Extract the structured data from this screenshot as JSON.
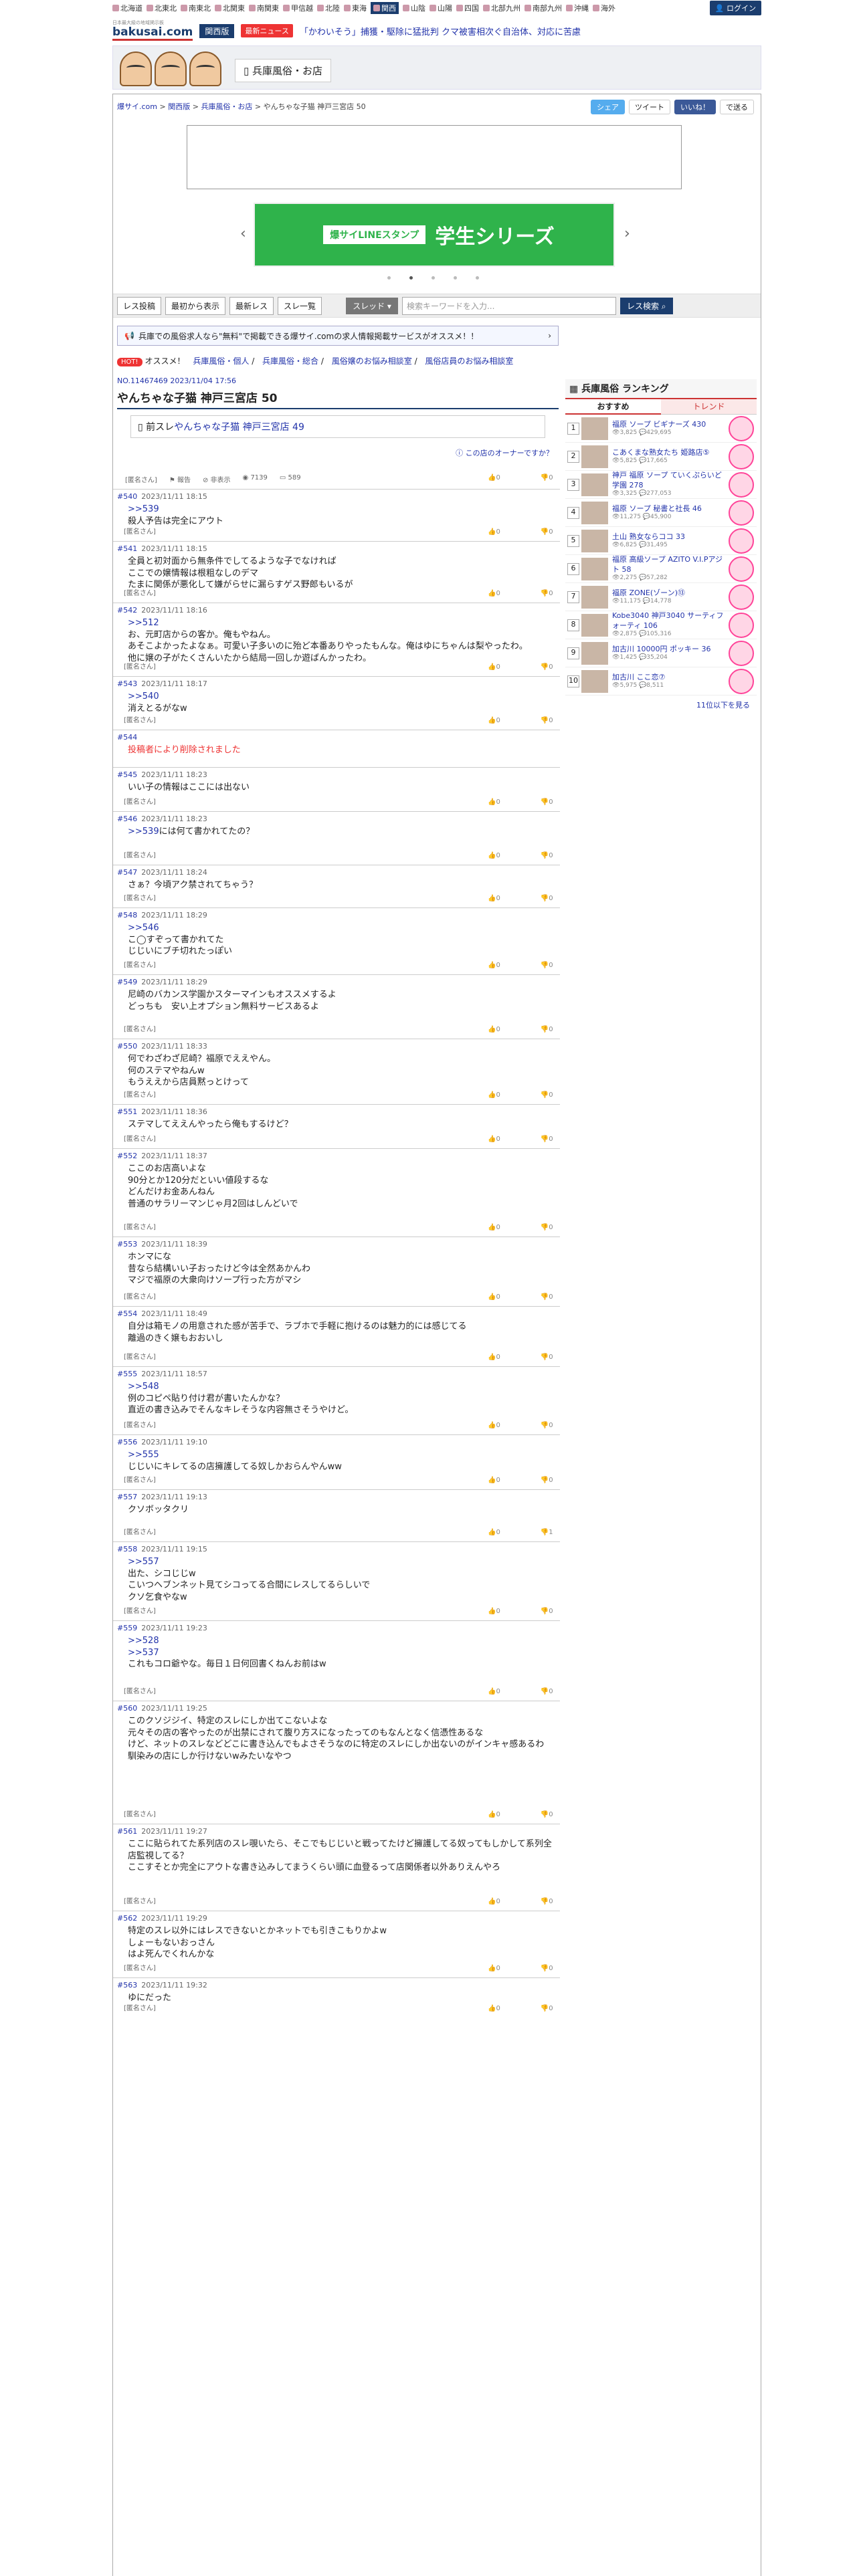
{
  "header": {
    "regions": [
      "北海道",
      "北東北",
      "南東北",
      "北関東",
      "南関東",
      "甲信越",
      "北陸",
      "東海",
      "関西",
      "山陰",
      "山陽",
      "四国",
      "北部九州",
      "南部九州",
      "沖縄",
      "海外"
    ],
    "active_region": "関西",
    "login": "ログイン",
    "logo": "bakusai.com",
    "logo_sub": "日本最大級の地域掲示板",
    "area_label": "関西版",
    "news_badge": "最新ニュース",
    "ticker": "「かわいそう」捕獲・駆除に猛批判 クマ被害相次ぐ自治体、対応に苦慮",
    "category_tab": "兵庫風俗・お店"
  },
  "breadcrumb": [
    "爆サイ.com",
    "関西版",
    "兵庫風俗・お店",
    "やんちゃな子猫 神戸三宮店 50"
  ],
  "social": {
    "share": "シェア",
    "tweet": "ツイート",
    "like": "いいね！",
    "save": "で送る"
  },
  "carousel": {
    "banner": "学生シリーズ",
    "banner_sub": "爆サイLINEスタンプ"
  },
  "toolbar": {
    "buttons": [
      "レス投稿",
      "最初から表示",
      "最新レス",
      "スレ一覧"
    ],
    "select": "スレッド",
    "search_placeholder": "検索キーワードを入力...",
    "search_button": "レス検索"
  },
  "recruit_banner": "兵庫での風俗求人なら\"無料\"で掲載できる爆サイ.comの求人情報掲載サービスがオススメ！！",
  "osusume": {
    "hot": "HOT!",
    "label": "オススメ！",
    "links": [
      "兵庫風俗・個人",
      "兵庫風俗・総合",
      "風俗嬢のお悩み相談室",
      "風俗店員のお悩み相談室"
    ]
  },
  "thread": {
    "info": "NO.11467469 2023/11/04 17:56",
    "title": "やんちゃな子猫 神戸三宮店 50",
    "prev_prefix": "前スレ",
    "prev_link": "やんちゃな子猫 神戸三宮店 49",
    "owner_link": "この店のオーナーですか？",
    "op_name": "[匿名さん]",
    "report": "報告",
    "block": "非表示",
    "views": "7139",
    "comments": "589",
    "good": "0",
    "bad": "0"
  },
  "posts": [
    {
      "no": "#540",
      "date": "2023/11/11 18:15",
      "anchor": ">>539",
      "text": "殺人予告は完全にアウト",
      "name": "[匿名さん]",
      "good": "0",
      "bad": "0"
    },
    {
      "no": "#541",
      "date": "2023/11/11 18:15",
      "anchor": "",
      "text": "全員と初対面から無条件でしてるような子でなければ\nここでの嬢情報は根粗なしのデマ\nたまに関係が悪化して嫌がらせに漏らすゲス野郎もいるが",
      "name": "[匿名さん]",
      "good": "0",
      "bad": "0"
    },
    {
      "no": "#542",
      "date": "2023/11/11 18:16",
      "anchor": ">>512",
      "text": "お、元町店からの客か。俺もやねん。\nあそこよかったよなぁ。可愛い子多いのに殆ど本番ありやったもんな。俺はゆにちゃんは梨やったわ。\n他に嬢の子がたくさんいたから結局一回しか遊ばんかったわ。",
      "name": "[匿名さん]",
      "good": "0",
      "bad": "0"
    },
    {
      "no": "#543",
      "date": "2023/11/11 18:17",
      "anchor": ">>540",
      "text": "消えとるがなw",
      "name": "[匿名さん]",
      "good": "0",
      "bad": "0"
    },
    {
      "no": "#544",
      "date": "",
      "anchor": "",
      "text": "",
      "deleted": "投稿者により削除されました",
      "name": "",
      "good": "",
      "bad": ""
    },
    {
      "no": "#545",
      "date": "2023/11/11 18:23",
      "anchor": "",
      "text": "いい子の情報はここには出ない",
      "name": "[匿名さん]",
      "good": "0",
      "bad": "0"
    },
    {
      "no": "#546",
      "date": "2023/11/11 18:23",
      "anchor": ">>539",
      "text": "には何て書かれてたの？",
      "name": "[匿名さん]",
      "good": "0",
      "bad": "0"
    },
    {
      "no": "#547",
      "date": "2023/11/11 18:24",
      "anchor": "",
      "text": "さぁ？今頃アク禁されてちゃう？",
      "name": "[匿名さん]",
      "good": "0",
      "bad": "0"
    },
    {
      "no": "#548",
      "date": "2023/11/11 18:29",
      "anchor": ">>546",
      "text": "こ◯すぞって書かれてた\nじじいにブチ切れたっぽい",
      "name": "[匿名さん]",
      "good": "0",
      "bad": "0"
    },
    {
      "no": "#549",
      "date": "2023/11/11 18:29",
      "anchor": "",
      "text": "尼崎のバカンス学園かスターマインもオススメするよ\nどっちも　安い上オプション無料サービスあるよ",
      "name": "[匿名さん]",
      "good": "0",
      "bad": "0"
    },
    {
      "no": "#550",
      "date": "2023/11/11 18:33",
      "anchor": "",
      "text": "何でわざわざ尼崎？福原でええやん。\n何のステマやねんw\nもうええから店員黙っとけって",
      "name": "[匿名さん]",
      "good": "0",
      "bad": "0"
    },
    {
      "no": "#551",
      "date": "2023/11/11 18:36",
      "anchor": "",
      "text": "ステマしてええんやったら俺もするけど？",
      "name": "[匿名さん]",
      "good": "0",
      "bad": "0"
    },
    {
      "no": "#552",
      "date": "2023/11/11 18:37",
      "anchor": "",
      "text": "ここのお店高いよな\n90分とか120分だといい値段するな\nどんだけお金あんねん\n普通のサラリーマンじゃ月2回はしんどいで",
      "name": "[匿名さん]",
      "good": "0",
      "bad": "0"
    },
    {
      "no": "#553",
      "date": "2023/11/11 18:39",
      "anchor": "",
      "text": "ホンマにな\n昔なら結構いい子おったけど今は全然あかんわ\nマジで福原の大衆向けソープ行った方がマシ",
      "name": "[匿名さん]",
      "good": "0",
      "bad": "0"
    },
    {
      "no": "#554",
      "date": "2023/11/11 18:49",
      "anchor": "",
      "text": "自分は箱モノの用意された感が苦手で、ラブホで手軽に抱けるのは魅力的には感じてる\n離過のきく嬢もおおいし",
      "name": "[匿名さん]",
      "good": "0",
      "bad": "0"
    },
    {
      "no": "#555",
      "date": "2023/11/11 18:57",
      "anchor": ">>548",
      "text": "例のコピペ貼り付け君が書いたんかな？\n直近の書き込みでそんなキレそうな内容無さそうやけど。",
      "name": "[匿名さん]",
      "good": "0",
      "bad": "0"
    },
    {
      "no": "#556",
      "date": "2023/11/11 19:10",
      "anchor": ">>555",
      "text": "じじいにキレてるの店擁護してる奴しかおらんやんww",
      "name": "[匿名さん]",
      "good": "0",
      "bad": "0"
    },
    {
      "no": "#557",
      "date": "2023/11/11 19:13",
      "anchor": "",
      "text": "クソボッタクリ",
      "name": "[匿名さん]",
      "good": "0",
      "bad": "1"
    },
    {
      "no": "#558",
      "date": "2023/11/11 19:15",
      "anchor": ">>557",
      "text": "出た、シコじじw\nこいつヘブンネット見てシコってる合間にレスしてるらしいで\nクソ乞食やなw",
      "name": "[匿名さん]",
      "good": "0",
      "bad": "0"
    },
    {
      "no": "#559",
      "date": "2023/11/11 19:23",
      "anchor": ">>528\n>>537",
      "text": "これもコロ爺やな。毎日１日何回書くねんお前はw",
      "name": "[匿名さん]",
      "good": "0",
      "bad": "0"
    },
    {
      "no": "#560",
      "date": "2023/11/11 19:25",
      "anchor": "",
      "text": "このクソジジイ、特定のスレにしか出てこないよな\n元々その店の客やったのが出禁にされて腹り方スになったってのもなんとなく信憑性あるな\nけど、ネットのスレなどどこに書き込んでもよさそうなのに特定のスレにしか出ないのがインキャ感あるわ\n馴染みの店にしか行けないwみたいなやつ",
      "name": "[匿名さん]",
      "good": "0",
      "bad": "0"
    },
    {
      "no": "#561",
      "date": "2023/11/11 19:27",
      "anchor": "",
      "text": "ここに貼られてた系列店のスレ覗いたら、そこでもじじいと戦ってたけど擁護してる奴ってもしかして系列全店監視してる？\nここすそとか完全にアウトな書き込みしてまうくらい頭に血登るって店関係者以外ありえんやろ",
      "name": "[匿名さん]",
      "good": "0",
      "bad": "0"
    },
    {
      "no": "#562",
      "date": "2023/11/11 19:29",
      "anchor": "",
      "text": "特定のスレ以外にはレスできないとかネットでも引きこもりかよw\nしょーもないおっさん\nはよ死んでくれんかな",
      "name": "[匿名さん]",
      "good": "0",
      "bad": "0"
    },
    {
      "no": "#563",
      "date": "2023/11/11 19:32",
      "anchor": "",
      "text": "ゆにだった",
      "name": "[匿名さん]",
      "good": "0",
      "bad": "0"
    }
  ],
  "ranking": {
    "title": "兵庫風俗 ランキング",
    "tabs": [
      "おすすめ",
      "トレンド"
    ],
    "items": [
      {
        "rank": "1",
        "name": "福原 ソープ ビギナーズ 430",
        "views": "3,825",
        "comments": "429,695"
      },
      {
        "rank": "2",
        "name": "こあくまな熟女たち 姫路店⑤",
        "views": "5,825",
        "comments": "17,665"
      },
      {
        "rank": "3",
        "name": "神戸 福原 ソープ ていくぷらいど 学園 278",
        "views": "3,325",
        "comments": "277,053"
      },
      {
        "rank": "4",
        "name": "福原 ソープ 秘書と社長 46",
        "views": "11,275",
        "comments": "45,900"
      },
      {
        "rank": "5",
        "name": "土山 熟女ならココ 33",
        "views": "6,825",
        "comments": "31,495"
      },
      {
        "rank": "6",
        "name": "福原 高級ソープ AZITO V.I.Pアジト 58",
        "views": "2,275",
        "comments": "57,282"
      },
      {
        "rank": "7",
        "name": "福原 ZONE(ゾーン)⑬",
        "views": "11,175",
        "comments": "14,778"
      },
      {
        "rank": "8",
        "name": "Kobe3040 神戸3040 サーティフォーティ 106",
        "views": "2,875",
        "comments": "105,316"
      },
      {
        "rank": "9",
        "name": "加古川 10000円 ポッキー 36",
        "views": "1,425",
        "comments": "35,204"
      },
      {
        "rank": "10",
        "name": "加古川 ここ恋⑦",
        "views": "5,975",
        "comments": "8,511"
      }
    ],
    "more": "11位以下を見る"
  }
}
